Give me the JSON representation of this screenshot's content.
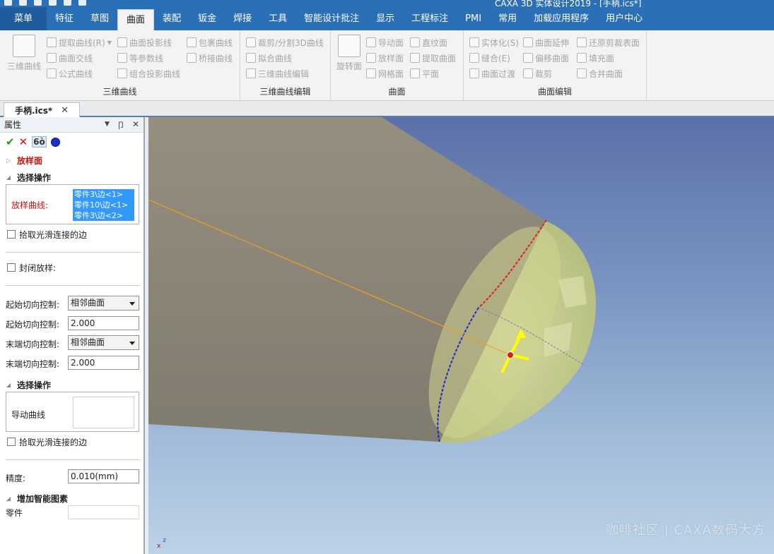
{
  "window": {
    "title": "CAXA 3D 实体设计2019 - [手柄.ics*]"
  },
  "ribbon_tabs": [
    {
      "label": "菜单"
    },
    {
      "label": "特征"
    },
    {
      "label": "草图"
    },
    {
      "label": "曲面",
      "active": true
    },
    {
      "label": "装配"
    },
    {
      "label": "钣金"
    },
    {
      "label": "焊接"
    },
    {
      "label": "工具"
    },
    {
      "label": "智能设计批注"
    },
    {
      "label": "显示"
    },
    {
      "label": "工程标注"
    },
    {
      "label": "PMI"
    },
    {
      "label": "常用"
    },
    {
      "label": "加载应用程序"
    },
    {
      "label": "用户中心"
    }
  ],
  "ribbon": {
    "group_3d_curve": {
      "label": "三维曲线",
      "big": "三维曲线",
      "items": [
        "提取曲线(R)",
        "曲面投影线",
        "包裹曲线",
        "曲面交线",
        "等参数线",
        "桥接曲线",
        "公式曲线",
        "组合投影曲线"
      ]
    },
    "group_3d_curve_edit": {
      "label": "三维曲线编辑",
      "items": [
        "裁剪/分割3D曲线",
        "拟合曲线",
        "三维曲线编辑"
      ]
    },
    "group_surface": {
      "label": "曲面",
      "big": "旋转面",
      "items": [
        "导动面",
        "直纹面",
        "放样面",
        "提取曲面",
        "网格面",
        "平面"
      ]
    },
    "group_surface_edit": {
      "label": "曲面编辑",
      "items": [
        "实体化(S)",
        "曲面延伸",
        "还原剪裁表面",
        "缝合(E)",
        "偏移曲面",
        "填充面",
        "曲面过渡",
        "裁剪",
        "合并曲面"
      ]
    }
  },
  "document_tab": {
    "label": "手柄.ics*",
    "close": "✕"
  },
  "property_panel": {
    "title": "属性",
    "ctrl_menu": "▼",
    "ctrl_pin": "卩",
    "ctrl_close": "✕",
    "ok": "✔",
    "cancel": "✕",
    "preview": "6ò",
    "feature_name": "放样面",
    "section1": "选择操作",
    "loft_curves_label": "放样曲线:",
    "loft_curves": [
      "零件3\\边<1>",
      "零件10\\边<1>",
      "零件3\\边<2>"
    ],
    "pick_smooth_1": "拾取光滑连接的边",
    "closed_loft": "封闭放样:",
    "start_tangent_ctrl_label": "起始切向控制:",
    "start_tangent_ctrl_value": "相邻曲面",
    "start_tangent_mag_label": "起始切向控制:",
    "start_tangent_mag_value": "2.000",
    "end_tangent_ctrl_label": "末端切向控制:",
    "end_tangent_ctrl_value": "相邻曲面",
    "end_tangent_mag_label": "末端切向控制:",
    "end_tangent_mag_value": "2.000",
    "section2": "选择操作",
    "guide_curve_label": "导动曲线",
    "pick_smooth_2": "拾取光滑连接的边",
    "precision_label": "精度:",
    "precision_value": "0.010(mm)",
    "section3": "增加智能图素",
    "part_label": "零件",
    "part_value": ""
  },
  "viewport": {
    "watermark": "咖啡社区 | CAXA数码大方",
    "axis_x": "x",
    "axis_z": "z"
  },
  "colors": {
    "ribbon_blue": "#2b6fb6",
    "part_body": "#8a8677",
    "loft_surface": "#c9cf8a",
    "red_edge": "#e02020",
    "blue_edge": "#1d2bc0"
  }
}
